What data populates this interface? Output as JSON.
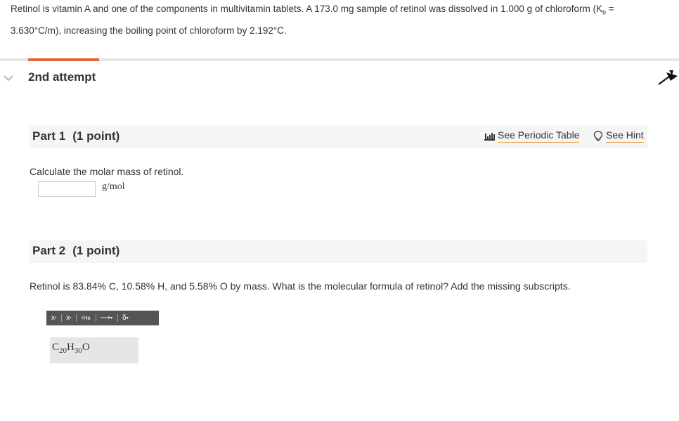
{
  "problem": {
    "line1_before": "Retinol is vitamin A and one of the components in multivitamin tablets. A 173.0 mg sample of retinol was dissolved in 1.000 g of chloroform (K",
    "line1_sub": "b",
    "line1_after": " =",
    "line2": "3.630°C/m), increasing the boiling point of chloroform by 2.192°C."
  },
  "attempt": {
    "title": "2nd attempt",
    "accent_color": "#e4643c"
  },
  "part1": {
    "label": "Part 1",
    "points": "(1 point)",
    "periodic_link": "See Periodic Table",
    "hint_link": "See Hint",
    "question": "Calculate the molar mass of retinol.",
    "input_value": "",
    "unit": "g/mol"
  },
  "part2": {
    "label": "Part 2",
    "points": "(1 point)",
    "question": "Retinol is 83.84% C, 10.58% H, and 5.58% O by mass. What is the molecular formula of retinol? Add the missing subscripts.",
    "toolbar": {
      "superscript": "x",
      "subscript": "x",
      "isotope_sup": "1",
      "isotope": "He",
      "arrow": "⟶",
      "delta": "δ"
    },
    "formula": {
      "el1": "C",
      "n1": "20",
      "el2": "H",
      "n2": "30",
      "el3": "O"
    }
  },
  "icons": [
    "chevron-down-icon",
    "pin-icon",
    "periodic-table-icon",
    "lightbulb-icon"
  ]
}
